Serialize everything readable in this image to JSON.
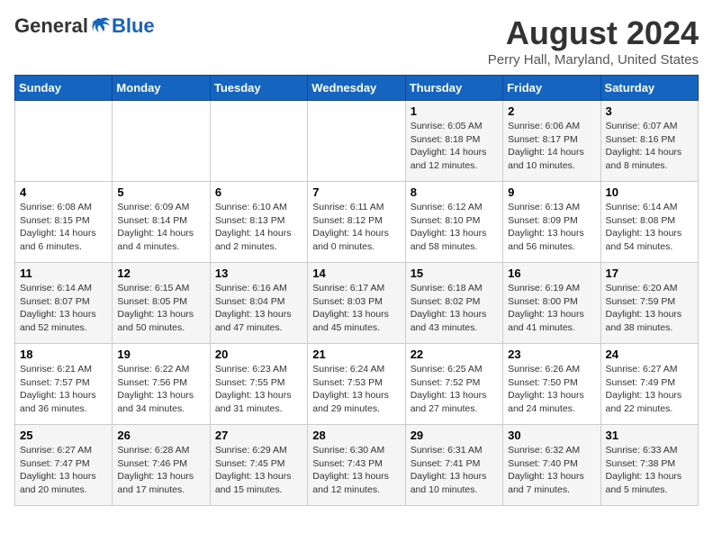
{
  "logo": {
    "general": "General",
    "blue": "Blue"
  },
  "header": {
    "month": "August 2024",
    "location": "Perry Hall, Maryland, United States"
  },
  "weekdays": [
    "Sunday",
    "Monday",
    "Tuesday",
    "Wednesday",
    "Thursday",
    "Friday",
    "Saturday"
  ],
  "weeks": [
    [
      {
        "day": "",
        "info": ""
      },
      {
        "day": "",
        "info": ""
      },
      {
        "day": "",
        "info": ""
      },
      {
        "day": "",
        "info": ""
      },
      {
        "day": "1",
        "info": "Sunrise: 6:05 AM\nSunset: 8:18 PM\nDaylight: 14 hours\nand 12 minutes."
      },
      {
        "day": "2",
        "info": "Sunrise: 6:06 AM\nSunset: 8:17 PM\nDaylight: 14 hours\nand 10 minutes."
      },
      {
        "day": "3",
        "info": "Sunrise: 6:07 AM\nSunset: 8:16 PM\nDaylight: 14 hours\nand 8 minutes."
      }
    ],
    [
      {
        "day": "4",
        "info": "Sunrise: 6:08 AM\nSunset: 8:15 PM\nDaylight: 14 hours\nand 6 minutes."
      },
      {
        "day": "5",
        "info": "Sunrise: 6:09 AM\nSunset: 8:14 PM\nDaylight: 14 hours\nand 4 minutes."
      },
      {
        "day": "6",
        "info": "Sunrise: 6:10 AM\nSunset: 8:13 PM\nDaylight: 14 hours\nand 2 minutes."
      },
      {
        "day": "7",
        "info": "Sunrise: 6:11 AM\nSunset: 8:12 PM\nDaylight: 14 hours\nand 0 minutes."
      },
      {
        "day": "8",
        "info": "Sunrise: 6:12 AM\nSunset: 8:10 PM\nDaylight: 13 hours\nand 58 minutes."
      },
      {
        "day": "9",
        "info": "Sunrise: 6:13 AM\nSunset: 8:09 PM\nDaylight: 13 hours\nand 56 minutes."
      },
      {
        "day": "10",
        "info": "Sunrise: 6:14 AM\nSunset: 8:08 PM\nDaylight: 13 hours\nand 54 minutes."
      }
    ],
    [
      {
        "day": "11",
        "info": "Sunrise: 6:14 AM\nSunset: 8:07 PM\nDaylight: 13 hours\nand 52 minutes."
      },
      {
        "day": "12",
        "info": "Sunrise: 6:15 AM\nSunset: 8:05 PM\nDaylight: 13 hours\nand 50 minutes."
      },
      {
        "day": "13",
        "info": "Sunrise: 6:16 AM\nSunset: 8:04 PM\nDaylight: 13 hours\nand 47 minutes."
      },
      {
        "day": "14",
        "info": "Sunrise: 6:17 AM\nSunset: 8:03 PM\nDaylight: 13 hours\nand 45 minutes."
      },
      {
        "day": "15",
        "info": "Sunrise: 6:18 AM\nSunset: 8:02 PM\nDaylight: 13 hours\nand 43 minutes."
      },
      {
        "day": "16",
        "info": "Sunrise: 6:19 AM\nSunset: 8:00 PM\nDaylight: 13 hours\nand 41 minutes."
      },
      {
        "day": "17",
        "info": "Sunrise: 6:20 AM\nSunset: 7:59 PM\nDaylight: 13 hours\nand 38 minutes."
      }
    ],
    [
      {
        "day": "18",
        "info": "Sunrise: 6:21 AM\nSunset: 7:57 PM\nDaylight: 13 hours\nand 36 minutes."
      },
      {
        "day": "19",
        "info": "Sunrise: 6:22 AM\nSunset: 7:56 PM\nDaylight: 13 hours\nand 34 minutes."
      },
      {
        "day": "20",
        "info": "Sunrise: 6:23 AM\nSunset: 7:55 PM\nDaylight: 13 hours\nand 31 minutes."
      },
      {
        "day": "21",
        "info": "Sunrise: 6:24 AM\nSunset: 7:53 PM\nDaylight: 13 hours\nand 29 minutes."
      },
      {
        "day": "22",
        "info": "Sunrise: 6:25 AM\nSunset: 7:52 PM\nDaylight: 13 hours\nand 27 minutes."
      },
      {
        "day": "23",
        "info": "Sunrise: 6:26 AM\nSunset: 7:50 PM\nDaylight: 13 hours\nand 24 minutes."
      },
      {
        "day": "24",
        "info": "Sunrise: 6:27 AM\nSunset: 7:49 PM\nDaylight: 13 hours\nand 22 minutes."
      }
    ],
    [
      {
        "day": "25",
        "info": "Sunrise: 6:27 AM\nSunset: 7:47 PM\nDaylight: 13 hours\nand 20 minutes."
      },
      {
        "day": "26",
        "info": "Sunrise: 6:28 AM\nSunset: 7:46 PM\nDaylight: 13 hours\nand 17 minutes."
      },
      {
        "day": "27",
        "info": "Sunrise: 6:29 AM\nSunset: 7:45 PM\nDaylight: 13 hours\nand 15 minutes."
      },
      {
        "day": "28",
        "info": "Sunrise: 6:30 AM\nSunset: 7:43 PM\nDaylight: 13 hours\nand 12 minutes."
      },
      {
        "day": "29",
        "info": "Sunrise: 6:31 AM\nSunset: 7:41 PM\nDaylight: 13 hours\nand 10 minutes."
      },
      {
        "day": "30",
        "info": "Sunrise: 6:32 AM\nSunset: 7:40 PM\nDaylight: 13 hours\nand 7 minutes."
      },
      {
        "day": "31",
        "info": "Sunrise: 6:33 AM\nSunset: 7:38 PM\nDaylight: 13 hours\nand 5 minutes."
      }
    ]
  ]
}
